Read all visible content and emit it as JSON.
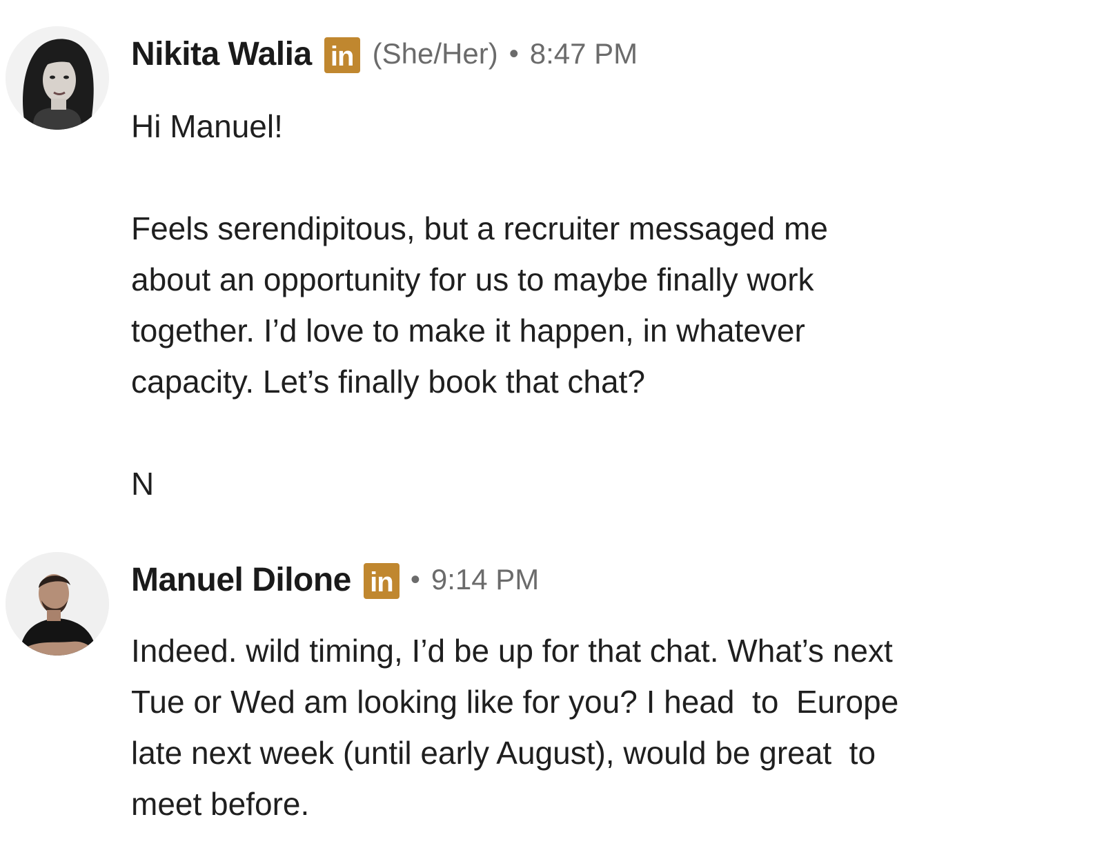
{
  "messages": [
    {
      "sender": "Nikita Walia",
      "badge": "in",
      "pronouns": "(She/Her)",
      "separator": "•",
      "time": "8:47 PM",
      "text": "Hi Manuel!\n\nFeels serendipitous, but a recruiter messaged me\nabout an opportunity for us to maybe finally work\ntogether. I’d love to make it happen, in whatever\ncapacity. Let’s finally book that chat?\n\nN"
    },
    {
      "sender": "Manuel Dilone",
      "badge": "in",
      "separator": "•",
      "time": "9:14 PM",
      "text": "Indeed. wild timing, I’d be up for that chat. What’s next\nTue or Wed am looking like for you? I head  to  Europe\nlate next week (until early August), would be great  to\nmeet before."
    }
  ],
  "colors": {
    "linkedin_badge": "#c0872f",
    "meta_text": "#6b6b6b",
    "body_text": "#1f1f1f"
  },
  "icons": {
    "badge": "linkedin-in-icon"
  }
}
